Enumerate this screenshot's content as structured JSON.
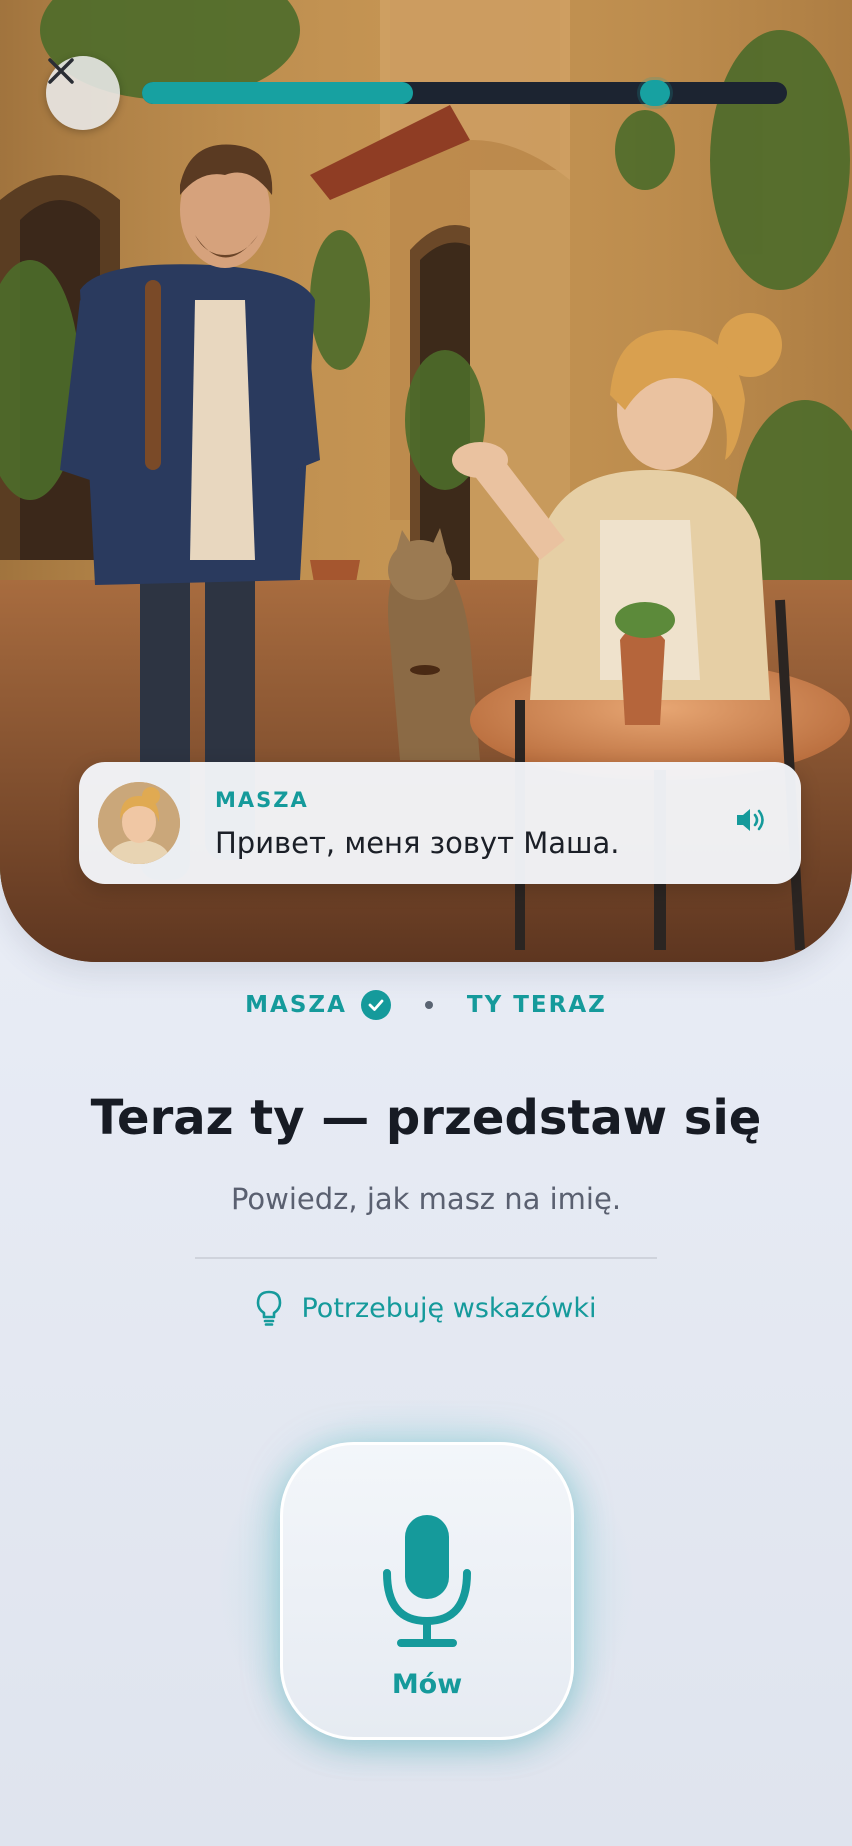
{
  "progress": {
    "fraction": 0.42,
    "marker_fraction": 0.795
  },
  "bubble": {
    "speaker": "MASZA",
    "text": "Привет, меня зовут Маша."
  },
  "steps": {
    "first": "MASZA",
    "second": "TY TERAZ"
  },
  "prompt": {
    "title": "Teraz ty — przedstaw się",
    "subtitle": "Powiedz, jak masz na imię."
  },
  "hint": {
    "label": "Potrzebuję wskazówki"
  },
  "mic": {
    "label": "Mów"
  },
  "colors": {
    "accent": "#159a9b",
    "text": "#171b24",
    "progress_track": "#1c2431"
  },
  "icons": {
    "close": "close-icon",
    "speaker": "speaker-icon",
    "check": "check-icon",
    "hint": "lightbulb-icon",
    "mic": "microphone-icon"
  }
}
